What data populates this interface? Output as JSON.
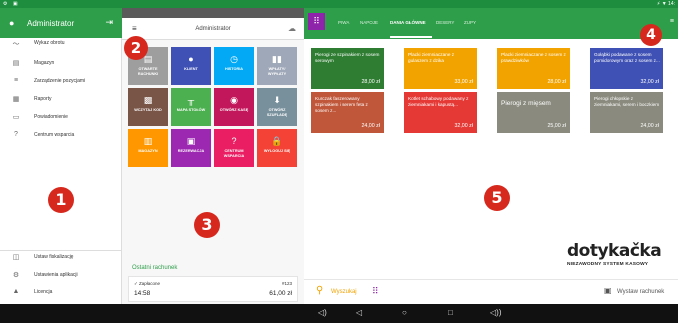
{
  "status_bar": {
    "left_icons": "⚙ ▣",
    "right_text": "⚡ ▼ 14:"
  },
  "sidebar": {
    "title": "Administrator",
    "items": [
      {
        "icon": "trend-icon",
        "glyph": "〜",
        "label": "Wykaz obrotu"
      },
      {
        "icon": "warehouse-icon",
        "glyph": "▤",
        "label": "Magazyn"
      },
      {
        "icon": "orders-icon",
        "glyph": "≡",
        "label": "Zarządzenie pozycjami"
      },
      {
        "icon": "reports-icon",
        "glyph": "▦",
        "label": "Raporty"
      },
      {
        "icon": "notification-icon",
        "glyph": "▭",
        "label": "Powiadomienie"
      },
      {
        "icon": "help-icon",
        "glyph": "?",
        "label": "Centrum wsparcia"
      }
    ],
    "bottom_items": [
      {
        "icon": "fiscal-icon",
        "glyph": "◫",
        "label": "Ustaw fiskalizację"
      },
      {
        "icon": "settings-icon",
        "glyph": "⚙",
        "label": "Ustawienia aplikacji"
      },
      {
        "icon": "license-icon",
        "glyph": "▲",
        "label": "Licencja"
      }
    ]
  },
  "badges": {
    "b1": "1",
    "b2": "2",
    "b3": "3",
    "b4": "4",
    "b5": "5"
  },
  "middle": {
    "title": "Administrator",
    "tiles": [
      {
        "label": "OTWARTE RACHUNKI",
        "glyph": "▤",
        "color": "#9e9e9e"
      },
      {
        "label": "KLIENT",
        "glyph": "●",
        "color": "#3f51b5"
      },
      {
        "label": "HISTORIA",
        "glyph": "◷",
        "color": "#03a9f4"
      },
      {
        "label": "WPŁATY/ WYPŁATY",
        "glyph": "▮▮",
        "color": "#9fa8b8"
      },
      {
        "label": "WCZYTAJ KOD",
        "glyph": "▩",
        "color": "#795548"
      },
      {
        "label": "MAPA STOŁÓW",
        "glyph": "╥",
        "color": "#4caf50"
      },
      {
        "label": "OTWÓRZ KASĘ",
        "glyph": "◉",
        "color": "#c2185b"
      },
      {
        "label": "OTWÓRZ SZUFLADĘ",
        "glyph": "⬇",
        "color": "#78909c"
      },
      {
        "label": "MAGAZYN",
        "glyph": "▥",
        "color": "#ff9800"
      },
      {
        "label": "REZERWACJA",
        "glyph": "▣",
        "color": "#9c27b0"
      },
      {
        "label": "CENTRUM WSPARCIA",
        "glyph": "?",
        "color": "#e91e63"
      },
      {
        "label": "WYLOGUJ SIĘ",
        "glyph": "🔒",
        "color": "#f44336"
      }
    ],
    "last_receipt": {
      "heading": "Ostatni rachunek",
      "status": "✓ Zapłacone",
      "number": "#123",
      "time": "14:58",
      "amount": "61,00 zł"
    }
  },
  "tabs": [
    {
      "label": "PIWA",
      "active": false
    },
    {
      "label": "NAPOJE",
      "active": false
    },
    {
      "label": "DANIA GŁÓWNE",
      "active": true
    },
    {
      "label": "DESERY",
      "active": false
    },
    {
      "label": "ZUPY",
      "active": false
    }
  ],
  "products": [
    {
      "name": "Pierogi ze szpinakiem z sosem serowym",
      "price": "28,00 zł",
      "color": "#2e7d32",
      "big": false
    },
    {
      "name": "Placki ziemniaczane z gulaszem z dzika",
      "price": "33,00 zł",
      "color": "#f2a300",
      "big": false
    },
    {
      "name": "Placki ziemniaczane z sosem z prawdziwków",
      "price": "28,00 zł",
      "color": "#f2a300",
      "big": false
    },
    {
      "name": "Gołąbki podawane z sosem pomidorowym oraz z sosem z...",
      "price": "32,00 zł",
      "color": "#3f51b5",
      "big": false
    },
    {
      "name": "Kurczak faszerowany szpinakiem i serem feta z sosem z...",
      "price": "24,00 zł",
      "color": "#c0573a",
      "big": false
    },
    {
      "name": "Kotlet schabowy podawany z ziemniakami i kapustą...",
      "price": "32,00 zł",
      "color": "#e53935",
      "big": false
    },
    {
      "name": "Pierogi z mięsem",
      "price": "25,00 zł",
      "color": "#8a8a7e",
      "big": true
    },
    {
      "name": "Pierogi chłopskie z ziemniakami, serem i boczkiem",
      "price": "24,00 zł",
      "color": "#8a8a7e",
      "big": false
    }
  ],
  "logo": {
    "word": "dotykačka",
    "tagline": "NIEZAWODNY SYSTEM KASOWY"
  },
  "bottom": {
    "search_label": "Wyszukaj",
    "receipt_label": "Wystaw rachunek"
  },
  "navbar": {
    "items": [
      "◁)",
      "◁",
      "○",
      "□",
      "◁))"
    ]
  }
}
